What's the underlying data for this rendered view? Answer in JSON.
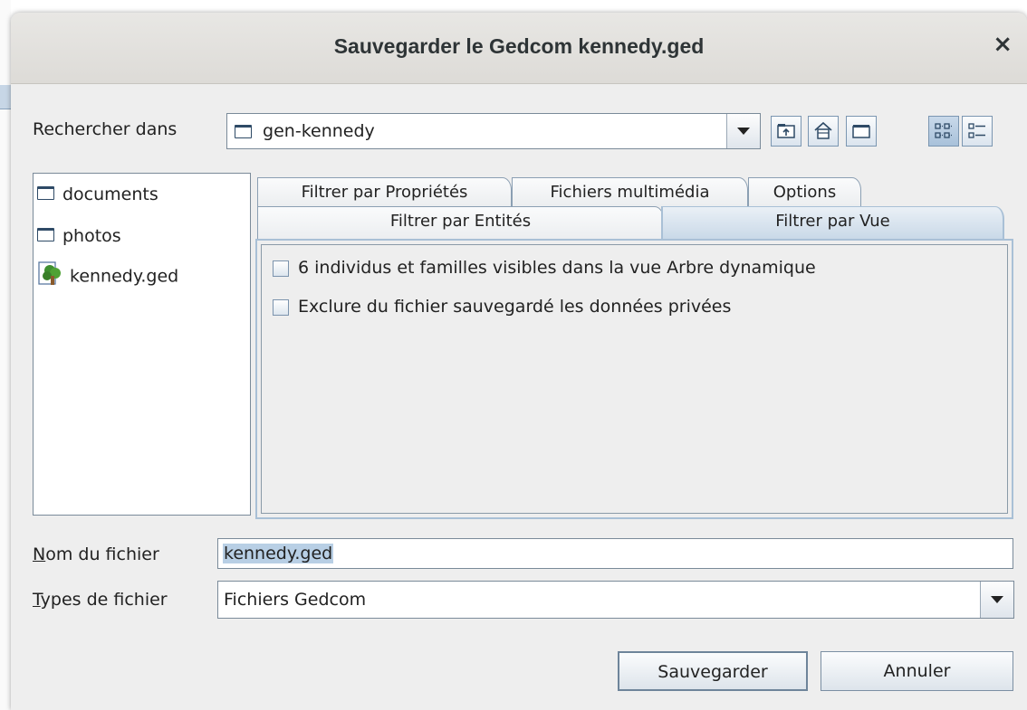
{
  "window": {
    "title": "Sauvegarder le Gedcom kennedy.ged",
    "close_label": "×"
  },
  "lookin": {
    "label": "Rechercher dans",
    "value": "gen-kennedy"
  },
  "toolbar": {
    "buttons": [
      {
        "icon": "up-folder-icon"
      },
      {
        "icon": "home-icon"
      },
      {
        "icon": "new-folder-icon"
      },
      {
        "icon": "list-view-icon",
        "selected": true
      },
      {
        "icon": "details-view-icon",
        "selected": false
      }
    ]
  },
  "files": [
    {
      "name": "documents",
      "icon": "folder-icon"
    },
    {
      "name": "photos",
      "icon": "folder-icon"
    },
    {
      "name": "kennedy.ged",
      "icon": "tree-icon"
    }
  ],
  "tabs": {
    "back_row": [
      "Filtrer par Propriétés",
      "Fichiers multimédia",
      "Options"
    ],
    "front_row": [
      "Filtrer par Entités",
      "Filtrer par Vue"
    ],
    "active": "Filtrer par Vue"
  },
  "options": [
    {
      "label": "6 individus et familles visibles dans la vue Arbre dynamique",
      "checked": false
    },
    {
      "label": "Exclure du fichier sauvegardé les données privées",
      "checked": false
    }
  ],
  "filename": {
    "label_first": "N",
    "label_rest": "om du fichier",
    "value": "kennedy.ged"
  },
  "filetype": {
    "label_first": "T",
    "label_rest": "ypes de fichier",
    "value": "Fichiers Gedcom"
  },
  "actions": {
    "save": "Sauvegarder",
    "cancel": "Annuler"
  },
  "colors": {
    "accent": "#a9c0d6",
    "selection": "#b8cfe5",
    "dialog_bg": "#eeeeee"
  }
}
